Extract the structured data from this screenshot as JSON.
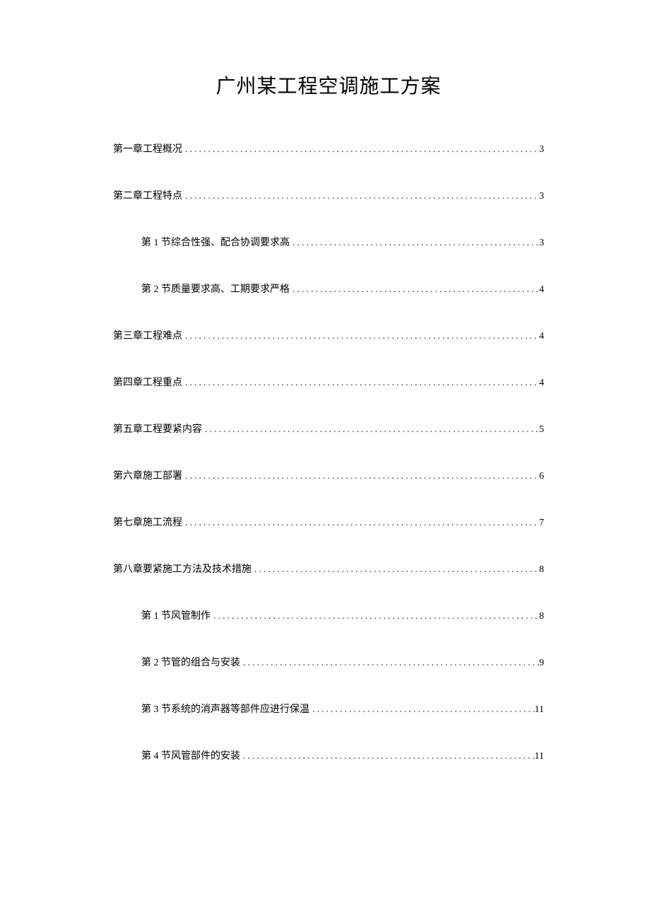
{
  "title": "广州某工程空调施工方案",
  "toc": [
    {
      "level": 1,
      "label": "第一章工程概况",
      "page": "3"
    },
    {
      "level": 1,
      "label": "第二章工程特点",
      "page": "3"
    },
    {
      "level": 2,
      "label": "第 1 节综合性强、配合协调要求高",
      "page": "3"
    },
    {
      "level": 2,
      "label": "第 2 节质量要求高、工期要求严格",
      "page": "4"
    },
    {
      "level": 1,
      "label": "第三章工程难点",
      "page": "4"
    },
    {
      "level": 1,
      "label": "第四章工程重点",
      "page": "4"
    },
    {
      "level": 1,
      "label": "第五章工程要紧内容",
      "page": "5"
    },
    {
      "level": 1,
      "label": "第六章施工部署",
      "page": "6"
    },
    {
      "level": 1,
      "label": "第七章施工流程",
      "page": "7"
    },
    {
      "level": 1,
      "label": "第八章要紧施工方法及技术措施",
      "page": "8"
    },
    {
      "level": 2,
      "label": "第 1 节风管制作",
      "page": "8"
    },
    {
      "level": 2,
      "label": "第 2 节管的组合与安装",
      "page": "9"
    },
    {
      "level": 2,
      "label": "第 3 节系统的消声器等部件应进行保温",
      "page": "11"
    },
    {
      "level": 2,
      "label": "第 4 节风管部件的安装",
      "page": "11"
    }
  ]
}
